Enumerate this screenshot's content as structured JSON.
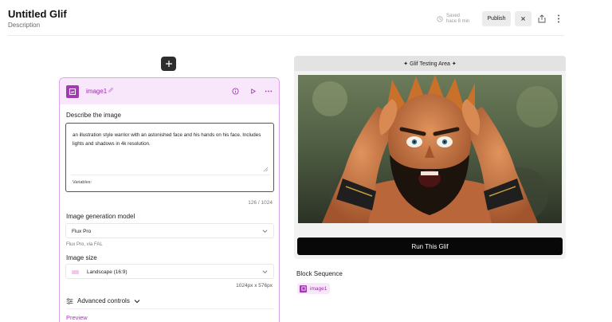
{
  "header": {
    "title": "Untitled Glif",
    "description": "Description",
    "saved_line1": "Saved",
    "saved_line2": "hace 8 min",
    "publish_label": "Publish"
  },
  "block": {
    "name": "image1",
    "prompt_label": "Describe the image",
    "prompt_text": "an illustration style warrior with an astonished face and his hands on his face. Includes lights and shadows in 4k resolution.",
    "variables_label": "Variables:",
    "char_count": "126 / 1024",
    "model_label": "Image generation model",
    "model_value": "Flux Pro",
    "model_sub": "Flux Pro, via FAL",
    "size_label": "Image size",
    "size_value": "Landscape (16:9)",
    "dimensions": "1024px x 576px",
    "advanced_label": "Advanced controls",
    "preview_label": "Preview"
  },
  "test_area": {
    "title": "✦ Glif Testing Area ✦",
    "run_label": "Run This Glif"
  },
  "sequence": {
    "title": "Block Sequence",
    "items": [
      {
        "label": "image1"
      }
    ]
  },
  "colors": {
    "accent": "#a13ab1",
    "accent_light": "#f8e6fb",
    "run_button": "#080808"
  },
  "icons": [
    "clock-icon",
    "close-icon",
    "share-icon",
    "more-vertical-icon",
    "plus-icon",
    "block-image-icon",
    "pencil-icon",
    "info-icon",
    "play-icon",
    "more-horizontal-icon",
    "chevron-down-icon",
    "sliders-icon"
  ]
}
